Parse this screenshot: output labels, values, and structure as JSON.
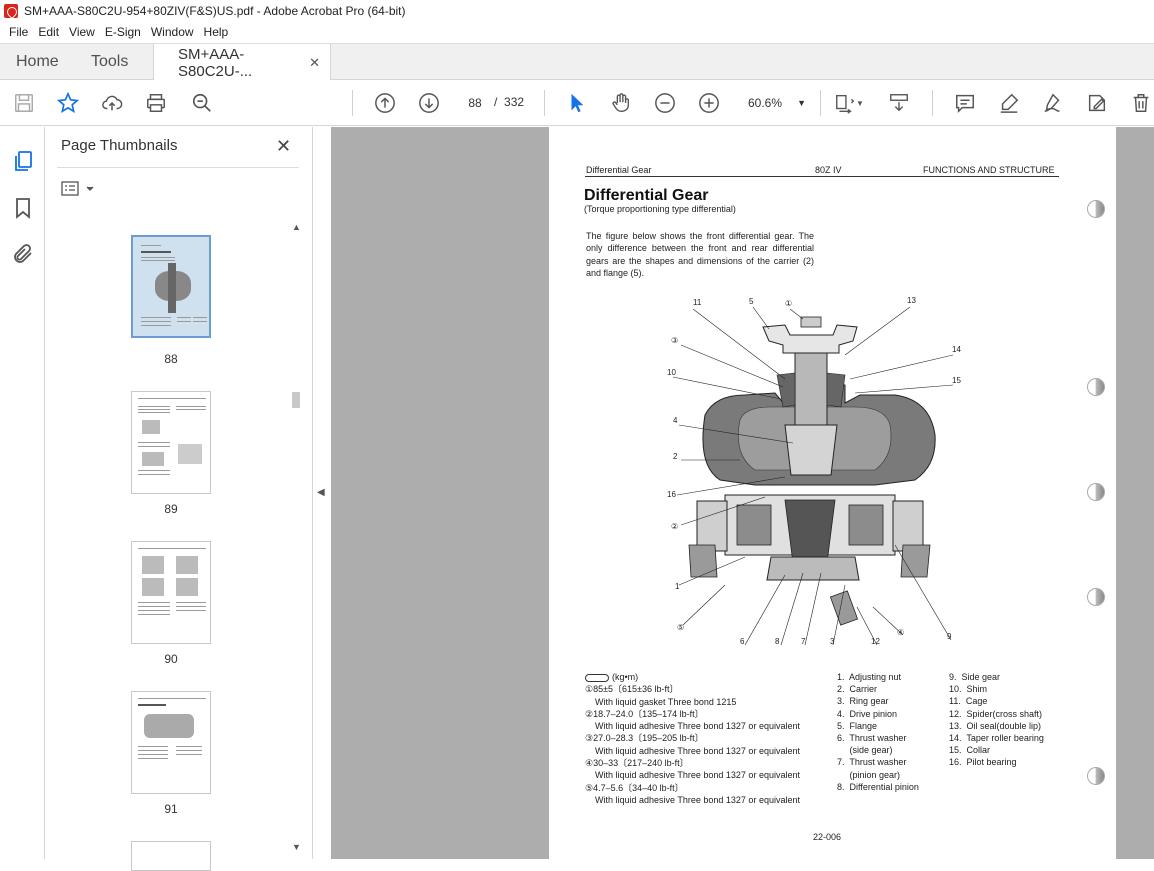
{
  "window": {
    "title": "SM+AAA-S80C2U-954+80ZIV(F&S)US.pdf - Adobe Acrobat Pro (64-bit)"
  },
  "menu": [
    "File",
    "Edit",
    "View",
    "E-Sign",
    "Window",
    "Help"
  ],
  "tabs": {
    "home": "Home",
    "tools": "Tools",
    "document": "SM+AAA-S80C2U-...",
    "close": "✕"
  },
  "toolbar": {
    "current_page": "88",
    "page_separator": "/",
    "total_pages": "332",
    "zoom": "60.6%"
  },
  "thumbnails": {
    "title": "Page Thumbnails",
    "close": "✕",
    "pages": [
      {
        "num": "88",
        "selected": true
      },
      {
        "num": "89",
        "selected": false
      },
      {
        "num": "90",
        "selected": false
      },
      {
        "num": "91",
        "selected": false
      }
    ]
  },
  "page": {
    "header_left": "Differential Gear",
    "header_mid": "80Z IV",
    "header_right": "FUNCTIONS AND STRUCTURE",
    "title": "Differential Gear",
    "subtitle": "(Torque proportioning type differential)",
    "intro": "The figure below shows the front differential gear. The only difference between the front and rear differential gears are the shapes and dimensions of the carrier (2) and flange (5).",
    "diagram_labels": [
      "11",
      "5",
      "①",
      "13",
      "③",
      "14",
      "10",
      "15",
      "4",
      "2",
      "16",
      "②",
      "1",
      "⑤",
      "6",
      "8",
      "7",
      "3",
      "12",
      "④",
      "9"
    ],
    "torque_unit": "(kg•m)",
    "torques": [
      {
        "value": "①85±5〔615±36 lb-ft〕",
        "note": "With liquid gasket Three bond 1215"
      },
      {
        "value": "②18.7–24.0〔135–174 lb-ft〕",
        "note": "With liquid adhesive Three bond 1327 or equivalent"
      },
      {
        "value": "③27.0–28.3〔195–205 lb-ft〕",
        "note": "With liquid adhesive Three bond 1327 or equivalent"
      },
      {
        "value": "④30–33〔217–240 lb-ft〕",
        "note": "With liquid adhesive Three bond 1327 or equivalent"
      },
      {
        "value": "⑤4.7–5.6〔34–40 lb-ft〕",
        "note": "With liquid adhesive Three bond 1327 or equivalent"
      }
    ],
    "parts_mid": [
      "1.  Adjusting nut",
      "2.  Carrier",
      "3.  Ring gear",
      "4.  Drive pinion",
      "5.  Flange",
      "6.  Thrust washer",
      "     (side gear)",
      "7.  Thrust washer",
      "     (pinion gear)",
      "8.  Differential pinion"
    ],
    "parts_right": [
      "9.  Side gear",
      "10.  Shim",
      "11.  Cage",
      "12.  Spider(cross shaft)",
      "13.  Oil seal(double lip)",
      "14.  Taper roller bearing",
      "15.  Collar",
      "16.  Pilot bearing"
    ],
    "footer": "22-006"
  }
}
